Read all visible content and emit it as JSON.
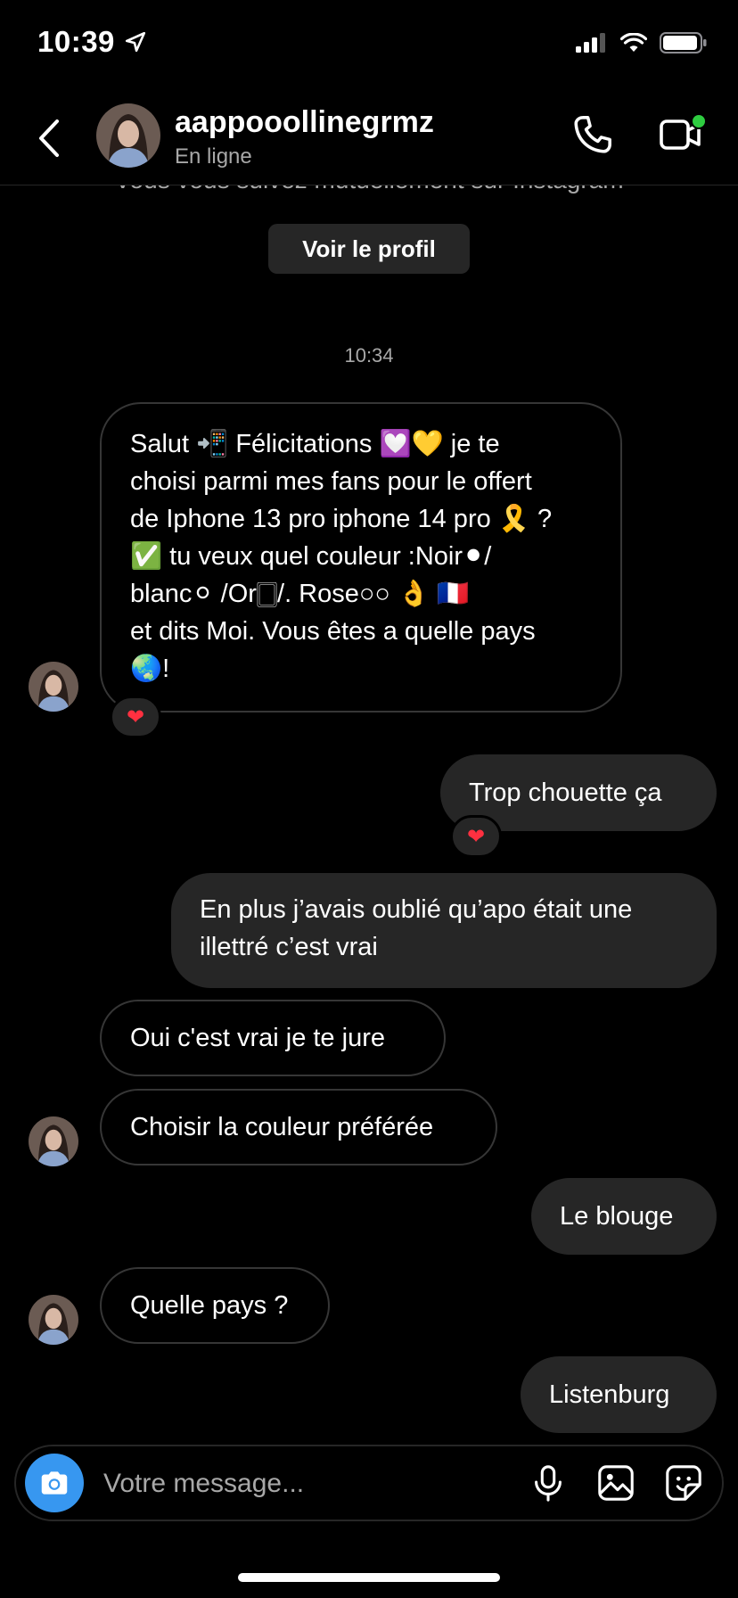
{
  "status_bar": {
    "time": "10:39"
  },
  "header": {
    "username": "aappooollinegrmz",
    "presence": "En ligne"
  },
  "profile_banner": {
    "mutual_text": "Vous vous suivez mutuellement sur Instagram",
    "button_label": "Voir le profil"
  },
  "timestamp": "10:34",
  "messages": [
    {
      "direction": "incoming",
      "lines": [
        "Salut 📲 Félicitations 💟💛 je te",
        "choisi parmi mes fans pour le offert",
        "de Iphone 13 pro iphone 14 pro 🎗️ ?",
        "✅ tu veux quel couleur :Noir⚫/",
        "blanc⚪ /Or🀆/. Rose○○ 👌 🇫🇷",
        "et dits Moi. Vous êtes a quelle pays",
        "🌏!"
      ],
      "reaction": "❤"
    },
    {
      "direction": "outgoing",
      "text": "Trop chouette ça",
      "reaction": "❤"
    },
    {
      "direction": "outgoing",
      "lines": [
        "En plus j’avais oublié qu’apo était une",
        "illettré c’est vrai"
      ]
    },
    {
      "direction": "incoming",
      "text": "Oui c'est vrai je te jure"
    },
    {
      "direction": "incoming",
      "text": "Choisir la couleur préférée"
    },
    {
      "direction": "outgoing",
      "text": "Le blouge"
    },
    {
      "direction": "incoming",
      "text": "Quelle pays ?"
    },
    {
      "direction": "outgoing",
      "text": "Listenburg"
    }
  ],
  "composer": {
    "placeholder": "Votre message..."
  },
  "icons": {
    "back": "chevron-left-icon",
    "call": "phone-icon",
    "video": "video-camera-icon",
    "camera": "camera-icon",
    "mic": "microphone-icon",
    "gallery": "image-icon",
    "sticker": "sticker-icon"
  },
  "colors": {
    "background": "#000000",
    "outgoing_bubble": "#262626",
    "incoming_border": "#363636",
    "accent": "#3797f0",
    "online_dot": "#2ecc40",
    "reaction_heart": "#ff3040"
  }
}
